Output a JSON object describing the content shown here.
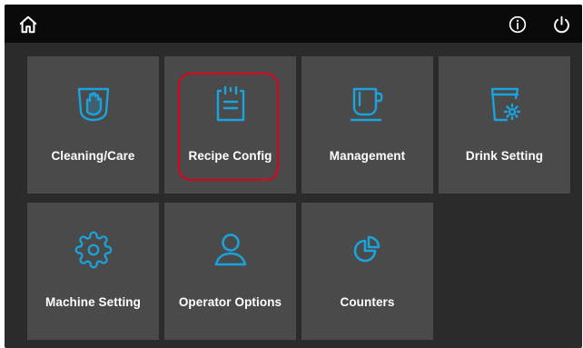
{
  "topbar": {
    "home_icon": "home-icon",
    "info_icon": "info-icon",
    "power_icon": "power-icon"
  },
  "colors": {
    "accent": "#1aa3dc",
    "tile_bg": "#4a4a4a",
    "panel_bg": "#2b2b2b",
    "topbar_bg": "#0a0a0a",
    "selection": "#e0001b"
  },
  "tiles": [
    {
      "label": "Cleaning/Care",
      "icon": "cleaning-hand-icon",
      "selected": false
    },
    {
      "label": "Recipe Config",
      "icon": "clipboard-icon",
      "selected": true
    },
    {
      "label": "Management",
      "icon": "coffee-cup-icon",
      "selected": false
    },
    {
      "label": "Drink Setting",
      "icon": "cup-gear-icon",
      "selected": false
    },
    {
      "label": "Machine Setting",
      "icon": "gear-icon",
      "selected": false
    },
    {
      "label": "Operator Options",
      "icon": "user-icon",
      "selected": false
    },
    {
      "label": "Counters",
      "icon": "pie-chart-icon",
      "selected": false
    }
  ]
}
